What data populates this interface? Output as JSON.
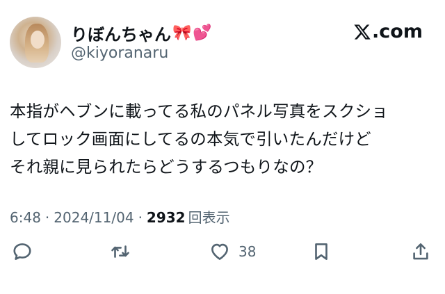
{
  "author": {
    "display_name": "りぼんちゃん",
    "name_emojis": [
      "🎀",
      "💕"
    ],
    "handle": "@kiyoranaru"
  },
  "brand": {
    "logo_text": ".com",
    "logo_icon": "x-logo-icon"
  },
  "tweet": {
    "lines": [
      "本指がヘブンに載ってる私のパネル写真をスクショ",
      "してロック画面にしてるの本気で引いたんだけど",
      "それ親に見られたらどうするつもりなの？"
    ]
  },
  "meta": {
    "time": "6:48",
    "separator": "·",
    "date": "2024/11/04",
    "views_count": "2932",
    "views_label": "回表示"
  },
  "actions": {
    "reply_icon": "reply-icon",
    "retweet_icon": "retweet-icon",
    "like_icon": "heart-icon",
    "like_count": "38",
    "bookmark_icon": "bookmark-icon",
    "share_icon": "share-icon"
  },
  "colors": {
    "text": "#0f1419",
    "secondary": "#536471",
    "background": "#ffffff"
  }
}
